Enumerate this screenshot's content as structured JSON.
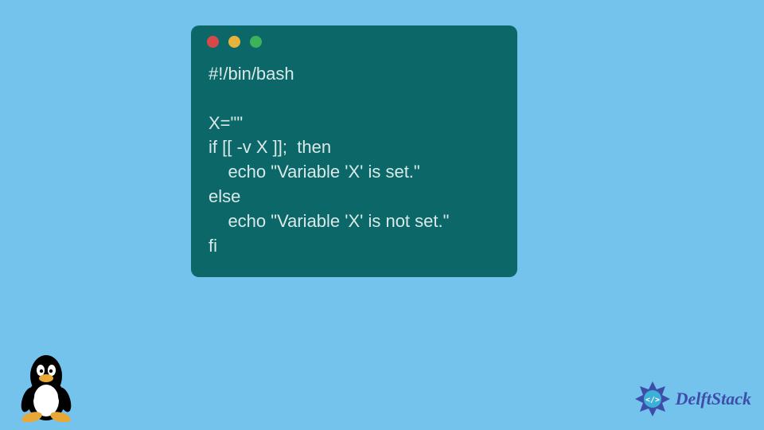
{
  "code_window": {
    "lines": [
      "#!/bin/bash",
      "",
      "X=\"\"",
      "if [[ -v X ]];  then",
      "    echo \"Variable 'X' is set.\"",
      "else",
      "    echo \"Variable 'X' is not set.\"",
      "fi"
    ]
  },
  "brand": {
    "name": "DelftStack"
  },
  "icons": {
    "bottom_left": "tux-linux-mascot",
    "bottom_right": "delftstack-logo"
  },
  "window_controls": {
    "close_color": "#d84848",
    "minimize_color": "#e8b33b",
    "zoom_color": "#3cb35a"
  }
}
